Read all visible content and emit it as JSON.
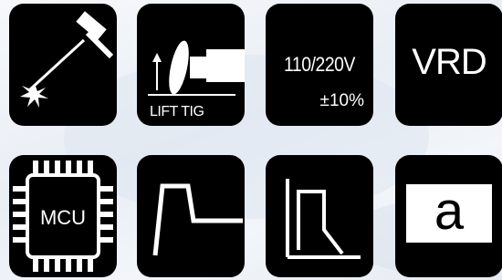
{
  "feature_icons": [
    {
      "name": "welding-torch",
      "label": ""
    },
    {
      "name": "lift-tig",
      "label": "LIFT TIG"
    },
    {
      "name": "voltage",
      "label": "110/220V",
      "tolerance": "±10%"
    },
    {
      "name": "vrd",
      "label": "VRD"
    },
    {
      "name": "mcu-chip",
      "label": "MCU"
    },
    {
      "name": "hot-start-curve",
      "label": ""
    },
    {
      "name": "arc-force-curve",
      "label": ""
    },
    {
      "name": "anti-stick",
      "label": "a"
    }
  ],
  "colors": {
    "tile": "#000000",
    "icon": "#ffffff",
    "background": "#eef2f7"
  }
}
